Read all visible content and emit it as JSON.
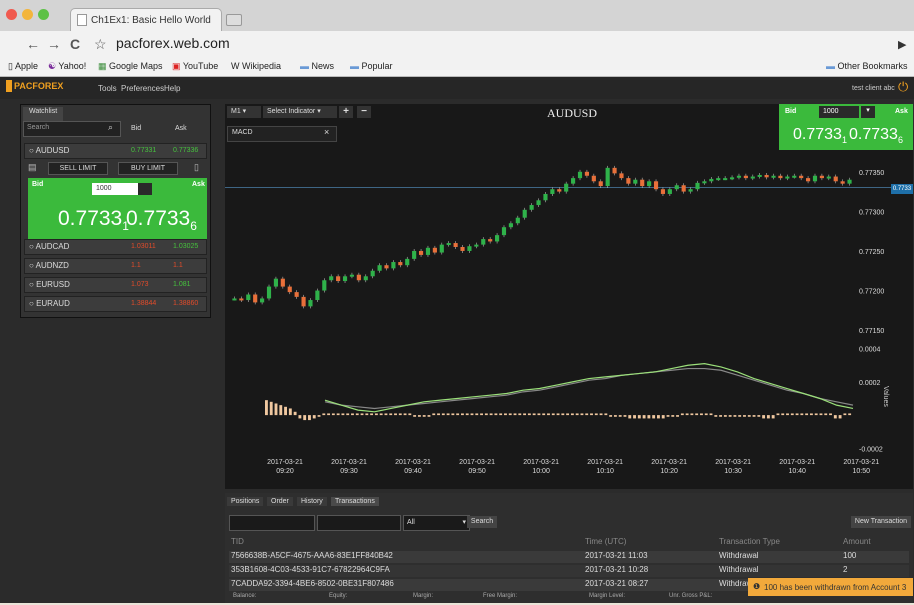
{
  "browser": {
    "tab_title": "Ch1Ex1: Basic Hello World",
    "url": "pacforex.web.com",
    "bookmarks": [
      "Apple",
      "Yahoo!",
      "Google Maps",
      "YouTube",
      "Wikipedia",
      "News",
      "Popular"
    ],
    "other_bookmarks": "Other Bookmarks"
  },
  "app": {
    "logo": "PACFOREX",
    "menu": [
      "Tools",
      "Preferences",
      "Help"
    ],
    "user": "test client abc"
  },
  "watchlist": {
    "tab": "Watchlist",
    "search_placeholder": "Search",
    "col_bid": "Bid",
    "col_ask": "Ask",
    "rows": [
      {
        "symbol": "AUDUSD",
        "bid": "0.77331",
        "ask": "0.77336"
      },
      {
        "symbol": "AUDCAD",
        "bid": "1.03011",
        "ask": "1.03025"
      },
      {
        "symbol": "AUDNZD",
        "bid": "1.1",
        "ask": "1.1"
      },
      {
        "symbol": "EURUSD",
        "bid": "1.073",
        "ask": "1.081"
      },
      {
        "symbol": "EURAUD",
        "bid": "1.38844",
        "ask": "1.38860"
      }
    ],
    "sell_limit": "SELL LIMIT",
    "buy_limit": "BUY LIMIT",
    "trade_bid": "Bid",
    "trade_ask": "Ask",
    "qty": "1000",
    "price_bid": "0.7733",
    "price_bid_sub": "1",
    "price_ask": "0.7733",
    "price_ask_sub": "6"
  },
  "chart": {
    "timeframe": "M1",
    "indicator_select": "Select Indicator",
    "plus": "+",
    "minus": "−",
    "symbol": "AUDUSD",
    "indicator_tag": "MACD",
    "close": "×",
    "trade_qty": "1000",
    "trade_bid_label": "Bid",
    "trade_ask_label": "Ask",
    "trade_bid": "0.7733",
    "trade_bid_sub": "1",
    "trade_ask": "0.7733",
    "trade_ask_sub": "6",
    "current_price": "0.7733",
    "values_label": "Values"
  },
  "chart_data": {
    "type": "candlestick",
    "symbol": "AUDUSD",
    "x_ticks": [
      [
        "2017-03-21",
        "09:20"
      ],
      [
        "2017-03-21",
        "09:30"
      ],
      [
        "2017-03-21",
        "09:40"
      ],
      [
        "2017-03-21",
        "09:50"
      ],
      [
        "2017-03-21",
        "10:00"
      ],
      [
        "2017-03-21",
        "10:10"
      ],
      [
        "2017-03-21",
        "10:20"
      ],
      [
        "2017-03-21",
        "10:30"
      ],
      [
        "2017-03-21",
        "10:40"
      ],
      [
        "2017-03-21",
        "10:50"
      ]
    ],
    "price_ticks": [
      "0.77350",
      "0.77300",
      "0.77250",
      "0.77200",
      "0.77150"
    ],
    "ylim": [
      0.77135,
      0.77375
    ],
    "close_prices": [
      0.7719,
      0.77188,
      0.77195,
      0.77185,
      0.7719,
      0.77205,
      0.77215,
      0.77205,
      0.77198,
      0.77192,
      0.7718,
      0.77188,
      0.772,
      0.77213,
      0.77218,
      0.77212,
      0.77218,
      0.7722,
      0.77213,
      0.77218,
      0.77225,
      0.77232,
      0.77228,
      0.77236,
      0.77232,
      0.7724,
      0.7725,
      0.77245,
      0.77254,
      0.77248,
      0.77258,
      0.7726,
      0.77255,
      0.7725,
      0.77256,
      0.77258,
      0.77265,
      0.77262,
      0.7727,
      0.7728,
      0.77285,
      0.77292,
      0.77302,
      0.77308,
      0.77314,
      0.77322,
      0.77328,
      0.77325,
      0.77335,
      0.77342,
      0.7735,
      0.77345,
      0.77338,
      0.77332,
      0.77355,
      0.77348,
      0.77342,
      0.77335,
      0.7734,
      0.77332,
      0.77338,
      0.77328,
      0.77322,
      0.77328,
      0.77333,
      0.77325,
      0.77328,
      0.77336,
      0.77338,
      0.77341,
      0.77342,
      0.77342,
      0.77343,
      0.77345,
      0.77342,
      0.77344,
      0.77346,
      0.77343,
      0.77345,
      0.77342,
      0.77344,
      0.77345,
      0.77342,
      0.77338,
      0.77345,
      0.77342,
      0.77344,
      0.77338,
      0.77335,
      0.7734
    ],
    "macd_ticks": [
      "0.0004",
      "0.0002",
      "-0.0002"
    ],
    "macd_ylim": [
      -0.00021,
      0.00044
    ],
    "macd_hist": [
      9e-05,
      8e-05,
      7e-05,
      6e-05,
      5e-05,
      4e-05,
      2e-05,
      -2e-05,
      -3e-05,
      -3e-05,
      -2e-05,
      -1e-05,
      1e-05,
      1e-05,
      1e-05,
      1e-05,
      1e-05,
      1e-05,
      1e-05,
      1e-05,
      1e-05,
      1e-05,
      1e-05,
      1e-05,
      1e-05,
      1e-05,
      1e-05,
      1e-05,
      1e-05,
      1e-05,
      1e-05,
      -1e-05,
      -1e-05,
      -1e-05,
      -1e-05,
      1e-05,
      1e-05,
      1e-05,
      1e-05,
      1e-05,
      1e-05,
      1e-05,
      1e-05,
      1e-05,
      1e-05,
      1e-05,
      1e-05,
      1e-05,
      1e-05,
      1e-05,
      1e-05,
      1e-05,
      1e-05,
      1e-05,
      1e-05,
      1e-05,
      1e-05,
      1e-05,
      1e-05,
      1e-05,
      1e-05,
      1e-05,
      1e-05,
      1e-05,
      1e-05,
      1e-05,
      1e-05,
      1e-05,
      1e-05,
      1e-05,
      1e-05,
      1e-05,
      -1e-05,
      -1e-05,
      -1e-05,
      -1e-05,
      -2e-05,
      -2e-05,
      -2e-05,
      -2e-05,
      -2e-05,
      -2e-05,
      -2e-05,
      -2e-05,
      -1e-05,
      -1e-05,
      -1e-05,
      1e-05,
      1e-05,
      1e-05,
      1e-05,
      1e-05,
      1e-05,
      1e-05,
      -1e-05,
      -1e-05,
      -1e-05,
      -1e-05,
      -1e-05,
      -1e-05,
      -1e-05,
      -1e-05,
      -1e-05,
      -1e-05,
      -2e-05,
      -2e-05,
      -2e-05,
      1e-05,
      1e-05,
      1e-05,
      1e-05,
      1e-05,
      1e-05,
      1e-05,
      1e-05,
      1e-05,
      1e-05,
      1e-05,
      1e-05,
      -2e-05,
      -2e-05,
      1e-05,
      1e-05
    ],
    "macd_line": [
      9e-05,
      6e-05,
      3e-05,
      2e-05,
      4e-05,
      6e-05,
      8e-05,
      9e-05,
      0.0001,
      0.00011,
      0.00012,
      0.00013,
      0.00015,
      0.00016,
      0.00018,
      0.0002,
      0.00022,
      0.00023,
      0.00024,
      0.00025,
      0.00026,
      0.00028,
      0.0003,
      0.00031,
      0.00029,
      0.00026,
      0.00022,
      0.00019,
      0.00016,
      0.00013,
      0.0001,
      6e-05,
      4e-05
    ],
    "signal_line": [
      8e-05,
      6e-05,
      5e-05,
      4e-05,
      5e-05,
      6e-05,
      7e-05,
      8e-05,
      9e-05,
      0.0001,
      0.00011,
      0.00012,
      0.00014,
      0.00015,
      0.00017,
      0.00019,
      0.00021,
      0.00022,
      0.00024,
      0.00025,
      0.00026,
      0.00027,
      0.00028,
      0.00028,
      0.00027,
      0.00024,
      0.00021,
      0.00018,
      0.00015,
      0.00013,
      0.0001,
      8e-05,
      6e-05
    ]
  },
  "bottom": {
    "tabs": [
      "Positions",
      "Order",
      "History",
      "Transactions"
    ],
    "filter": "All",
    "search_button": "Search",
    "new_transaction": "New Transaction",
    "columns": [
      "TID",
      "Time (UTC)",
      "Transaction Type",
      "Amount"
    ],
    "rows": [
      {
        "tid": "7566638B-A5CF-4675-AAA6-83E1FF840B42",
        "time": "2017-03-21 11:03",
        "type": "Withdrawal",
        "amount": "100"
      },
      {
        "tid": "353B1608-4C03-4533-91C7-67822964C9FA",
        "time": "2017-03-21 10:28",
        "type": "Withdrawal",
        "amount": "2"
      },
      {
        "tid": "7CADDA92-3394-4BE6-8502-0BE31F807486",
        "time": "2017-03-21 08:27",
        "type": "Withdrawal",
        "amount": ""
      }
    ],
    "footer": [
      "Balance:",
      "Equity:",
      "Margin:",
      "Free Margin:",
      "Margin Level:",
      "Unr. Gross P&L:"
    ]
  },
  "toast": {
    "text": "100 has been withdrawn from Account 3"
  }
}
